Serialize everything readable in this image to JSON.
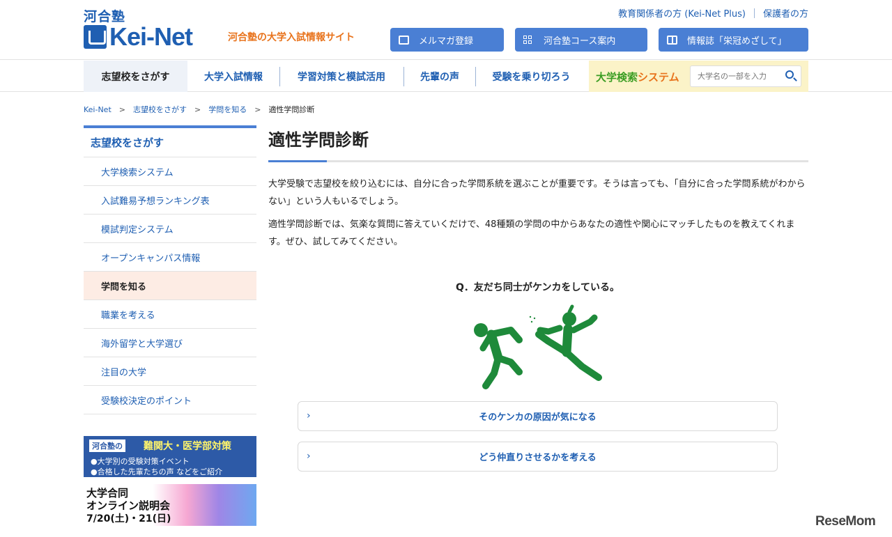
{
  "header": {
    "logo_small": "河合塾",
    "logo_main": "Kei-Net",
    "tagline": "河合塾の大学入試情報サイト",
    "top_links": [
      "教育関係者の方 (Kei-Net Plus)",
      "保護者の方"
    ],
    "buttons": [
      "メルマガ登録",
      "河合塾コース案内",
      "情報誌「栄冠めざして」"
    ]
  },
  "nav": {
    "items": [
      "志望校をさがす",
      "大学入試情報",
      "学習対策と模試活用",
      "先輩の声",
      "受験を乗り切ろう"
    ],
    "search_label_a": "大学検索",
    "search_label_b": "システム",
    "search_placeholder": "大学名の一部を入力"
  },
  "breadcrumb": [
    "Kei-Net",
    "志望校をさがす",
    "学問を知る",
    "適性学問診断"
  ],
  "sidebar": {
    "heading": "志望校をさがす",
    "items": [
      "大学検索システム",
      "入試難易予想ランキング表",
      "模試判定システム",
      "オープンキャンパス情報",
      "学問を知る",
      "職業を考える",
      "海外留学と大学選び",
      "注目の大学",
      "受験校決定のポイント"
    ]
  },
  "banners": {
    "b1_tag": "河合塾の",
    "b1_title": "難関大・医学部対策",
    "b1_line1": "●大学別の受験対策イベント",
    "b1_line2": "●合格した先輩たちの声 などをご紹介",
    "b2_line1": "大学合同",
    "b2_line2": "オンライン説明会",
    "b2_line3": "7/20(土)・21(日)"
  },
  "main": {
    "title": "適性学問診断",
    "para1": "大学受験で志望校を絞り込むには、自分に合った学問系統を選ぶことが重要です。そうは言っても、「自分に合った学問系統がわからない」という人もいるでしょう。",
    "para2": "適性学問診断では、気楽な質問に答えていくだけで、48種類の学問の中からあなたの適性や関心にマッチしたものを教えてくれます。ぜひ、試してみてください。",
    "question": "Q．友だち同士がケンカをしている。",
    "choices": [
      "そのケンカの原因が気になる",
      "どう仲直りさせるかを考える"
    ]
  },
  "colors": {
    "brand": "#1f5fb2",
    "button": "#4a7fd4",
    "accent_orange": "#e8731c",
    "figure_green": "#1e8a3a"
  },
  "watermark": "ReseMom"
}
